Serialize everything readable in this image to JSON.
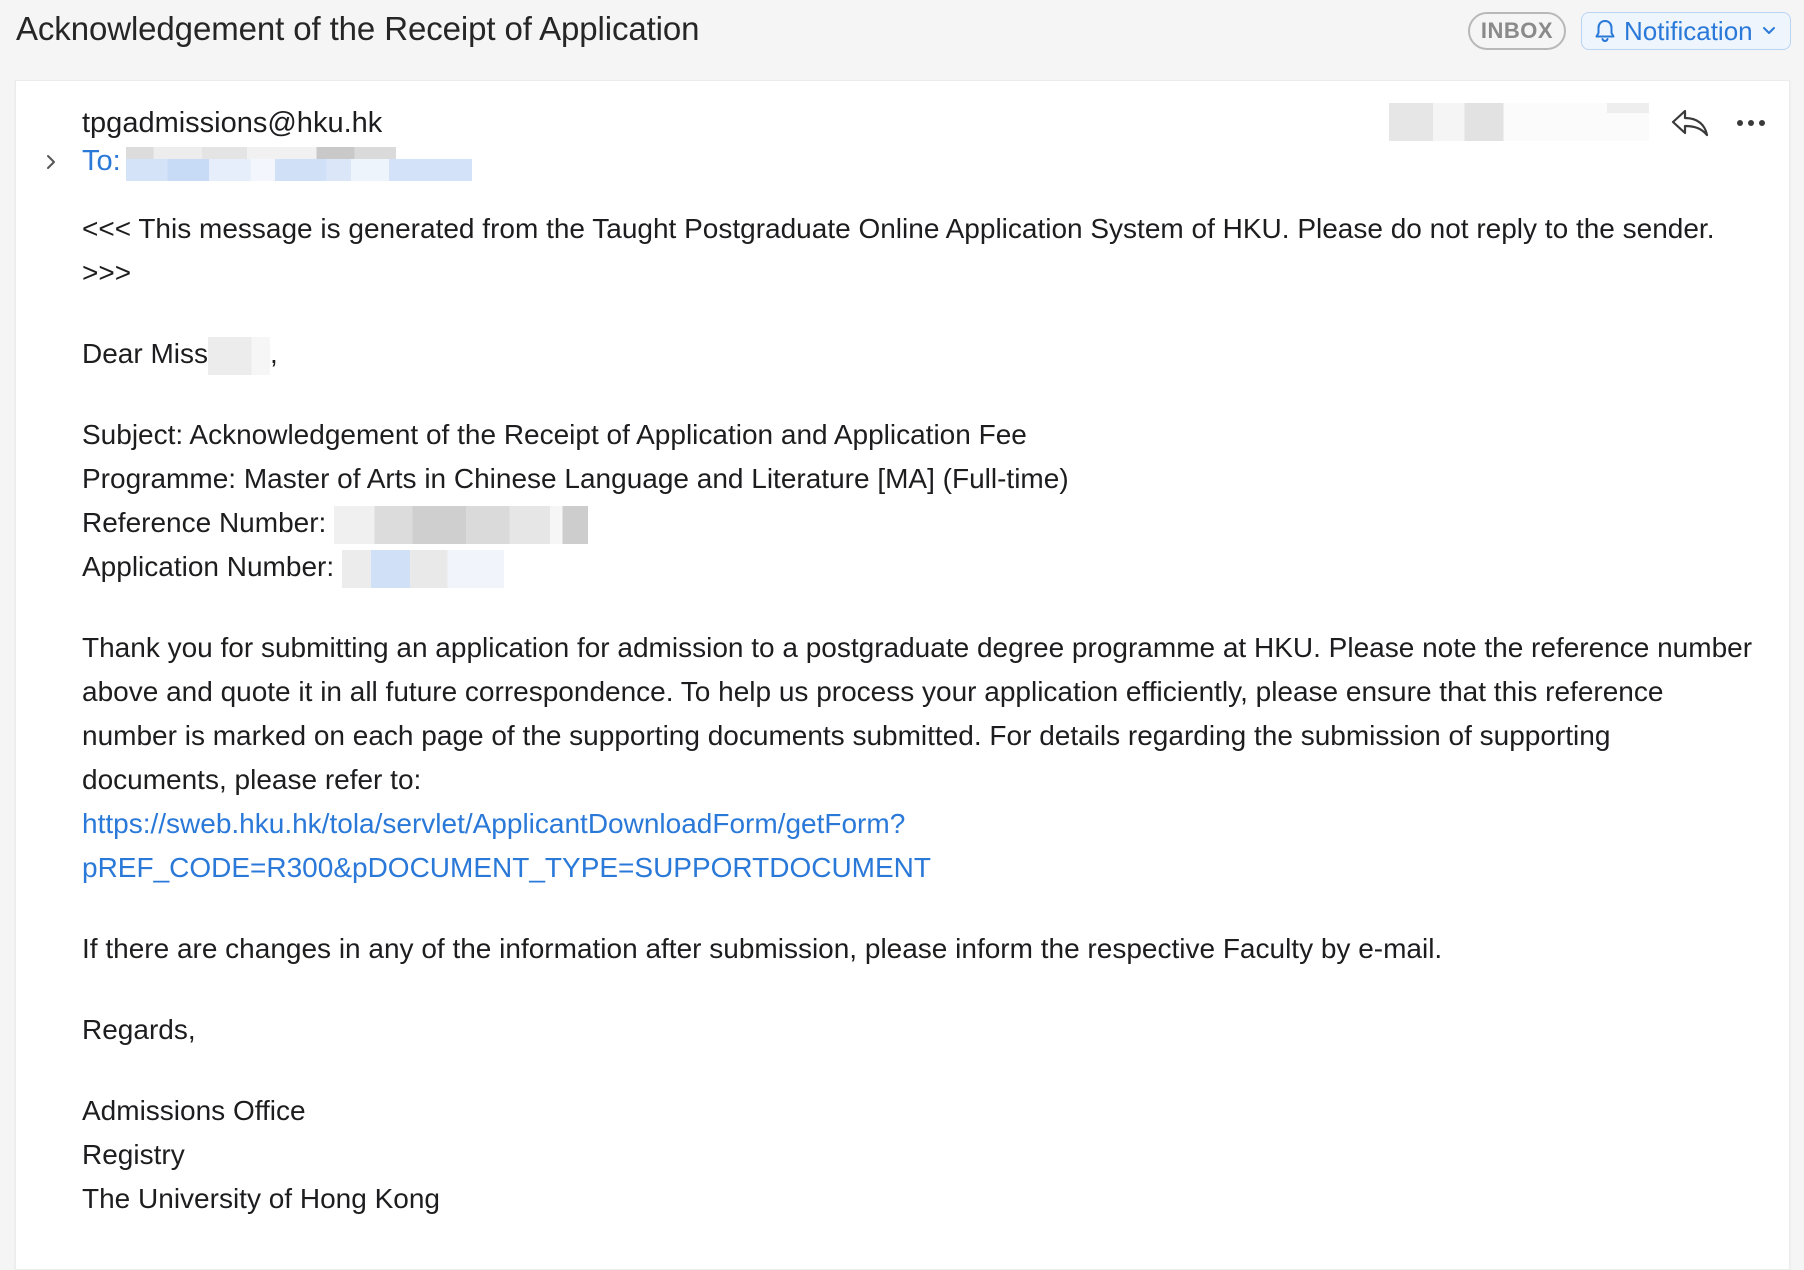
{
  "header": {
    "subject": "Acknowledgement of the Receipt of Application",
    "mailbox_badge": "INBOX",
    "notification_label": "Notification"
  },
  "message": {
    "from": "tpgadmissions@hku.hk",
    "to_label": "To:",
    "body": {
      "intro": "<<< This message is generated from the Taught Postgraduate Online Application System of HKU. Please do not reply to the sender. >>>",
      "greeting_prefix": "Dear Miss",
      "greeting_suffix": ",",
      "subject_line": "Subject: Acknowledgement of the Receipt of Application and Application Fee",
      "programme_line": "Programme: Master of Arts in Chinese Language and Literature [MA] (Full-time)",
      "reference_label": "Reference Number: ",
      "application_label": "Application Number: ",
      "paragraph1": "Thank you for submitting an application for admission to a postgraduate degree programme at HKU. Please note the reference number above and quote it in all future correspondence. To help us process your application efficiently, please ensure that this reference number is marked on each page of the supporting documents submitted. For details regarding the submission of supporting documents, please refer to:",
      "link_line1": "https://sweb.hku.hk/tola/servlet/ApplicantDownloadForm/getForm?",
      "link_line2": "pREF_CODE=R300&pDOCUMENT_TYPE=SUPPORTDOCUMENT",
      "paragraph2": "If there are changes in any of the information after submission, please inform the respective Faculty by e-mail.",
      "closing": "Regards,",
      "signature": [
        "Admissions Office",
        "Registry",
        "The University of Hong Kong"
      ]
    }
  },
  "colors": {
    "accent": "#2a79d8",
    "text": "#1d1d1f",
    "background": "#f5f5f5"
  }
}
